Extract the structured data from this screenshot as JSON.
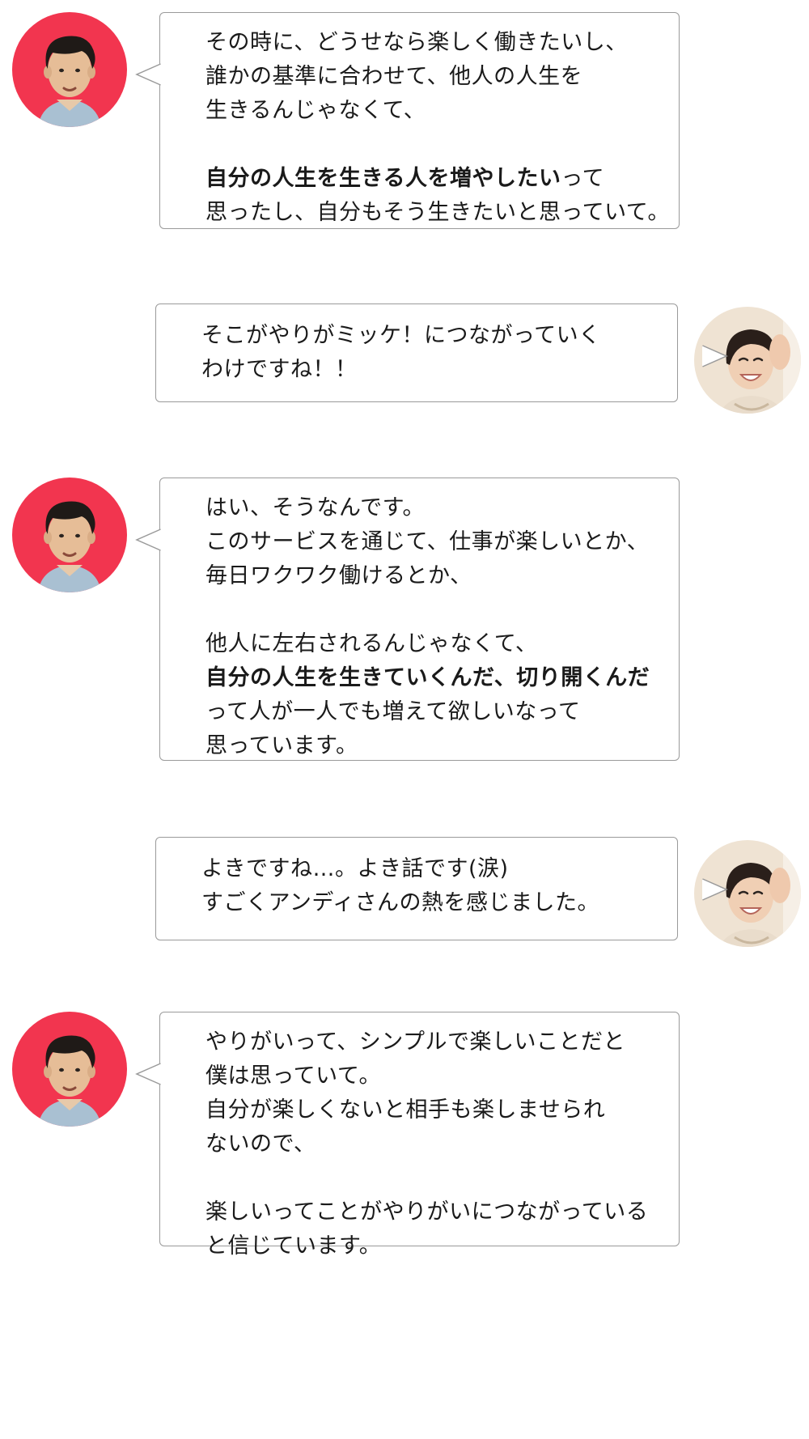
{
  "conversation": [
    {
      "speaker": "male",
      "side": "left",
      "lines": [
        [
          {
            "t": "その時に、どうせなら楽しく働きたいし、"
          }
        ],
        [
          {
            "t": "誰かの基準に合わせて、他人の人生を"
          }
        ],
        [
          {
            "t": "生きるんじゃなくて、"
          }
        ],
        [],
        [
          {
            "t": "自分の人生を生きる人を増やしたい",
            "b": true
          },
          {
            "t": "って"
          }
        ],
        [
          {
            "t": "思ったし、自分もそう生きたいと思っていて。"
          }
        ]
      ]
    },
    {
      "speaker": "female",
      "side": "right",
      "lines": [
        [
          {
            "t": "そこがやりがミッケ！につながっていく"
          }
        ],
        [
          {
            "t": "わけですね！！"
          }
        ]
      ]
    },
    {
      "speaker": "male",
      "side": "left",
      "lines": [
        [
          {
            "t": "はい、そうなんです。"
          }
        ],
        [
          {
            "t": "このサービスを通じて、仕事が楽しいとか、"
          }
        ],
        [
          {
            "t": "毎日ワクワク働けるとか、"
          }
        ],
        [],
        [
          {
            "t": "他人に左右されるんじゃなくて、"
          }
        ],
        [
          {
            "t": "自分の人生を生きていくんだ、切り開くんだ",
            "b": true
          }
        ],
        [
          {
            "t": "って人が一人でも増えて欲しいなって"
          }
        ],
        [
          {
            "t": "思っています。"
          }
        ]
      ]
    },
    {
      "speaker": "female",
      "side": "right",
      "lines": [
        [
          {
            "t": "よきですね…。よき話です(涙)"
          }
        ],
        [
          {
            "t": "すごくアンディさんの熱を感じました。"
          }
        ]
      ]
    },
    {
      "speaker": "male",
      "side": "left",
      "lines": [
        [
          {
            "t": "やりがいって、シンプルで楽しいことだと"
          }
        ],
        [
          {
            "t": "僕は思っていて。"
          }
        ],
        [
          {
            "t": "自分が楽しくないと相手も楽しませられ"
          }
        ],
        [
          {
            "t": "ないので、"
          }
        ],
        [],
        [
          {
            "t": "楽しいってことがやりがいにつながっている"
          }
        ],
        [
          {
            "t": "と信じています。"
          }
        ]
      ]
    }
  ],
  "colors": {
    "male_avatar_bg": "#f2354f",
    "female_avatar_bg": "#efe3d3",
    "bubble_border": "#9a9a9a"
  },
  "icons": {
    "male": "man-avatar-icon",
    "female": "woman-avatar-icon"
  }
}
